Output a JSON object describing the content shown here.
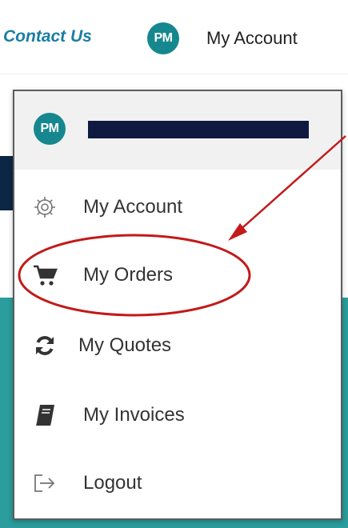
{
  "header": {
    "contact_label": "Contact Us",
    "avatar_initials": "PM",
    "account_label": "My Account"
  },
  "dropdown": {
    "avatar_initials": "PM",
    "items": [
      {
        "label": "My Account",
        "icon": "gear-icon"
      },
      {
        "label": "My Orders",
        "icon": "cart-icon"
      },
      {
        "label": "My Quotes",
        "icon": "refresh-icon"
      },
      {
        "label": "My Invoices",
        "icon": "book-icon"
      },
      {
        "label": "Logout",
        "icon": "logout-icon"
      }
    ]
  },
  "colors": {
    "avatar": "#16878f",
    "link": "#1a7ea3",
    "annotation": "#c21a1a",
    "teal_band": "#2a9d9c",
    "navy_band": "#0c2746"
  },
  "annotation": {
    "highlighted_item": "My Orders"
  }
}
